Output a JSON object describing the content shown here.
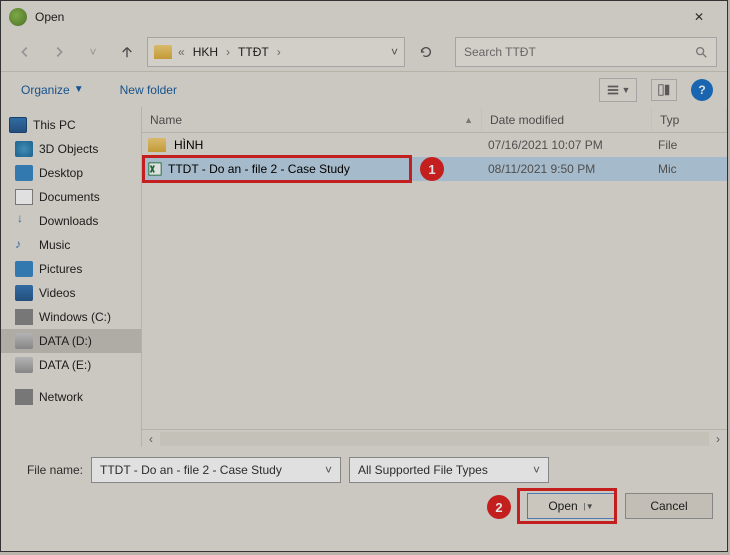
{
  "dialog": {
    "title": "Open"
  },
  "nav": {
    "back_disabled": true,
    "crumbs": {
      "pre": "«",
      "seg1": "HKH",
      "seg2": "TTĐT"
    },
    "search_placeholder": "Search TTĐT"
  },
  "toolbar": {
    "organize": "Organize",
    "new_folder": "New folder"
  },
  "sidebar": [
    {
      "label": "This PC",
      "ico": "ico-pc",
      "hdr": true
    },
    {
      "label": "3D Objects",
      "ico": "ico-3d"
    },
    {
      "label": "Desktop",
      "ico": "ico-desk"
    },
    {
      "label": "Documents",
      "ico": "ico-docs"
    },
    {
      "label": "Downloads",
      "ico": "ico-dl"
    },
    {
      "label": "Music",
      "ico": "ico-music"
    },
    {
      "label": "Pictures",
      "ico": "ico-pic"
    },
    {
      "label": "Videos",
      "ico": "ico-vid"
    },
    {
      "label": "Windows (C:)",
      "ico": "ico-winc"
    },
    {
      "label": "DATA (D:)",
      "ico": "ico-drive",
      "selected": true
    },
    {
      "label": "DATA (E:)",
      "ico": "ico-drive"
    },
    {
      "label": "Network",
      "ico": "ico-net"
    }
  ],
  "columns": {
    "name": "Name",
    "date": "Date modified",
    "type": "Typ"
  },
  "rows": [
    {
      "name": "HÌNH",
      "date": "07/16/2021 10:07 PM",
      "type": "File",
      "is_folder": true
    },
    {
      "name": "TTDT - Do an - file 2 - Case Study",
      "date": "08/11/2021 9:50 PM",
      "type": "Mic",
      "selected": true
    }
  ],
  "callouts": {
    "one": "1",
    "two": "2"
  },
  "bottom": {
    "label": "File name:",
    "filename": "TTDT - Do an - file 2 - Case Study",
    "filter": "All Supported File Types",
    "open": "Open",
    "cancel": "Cancel"
  }
}
